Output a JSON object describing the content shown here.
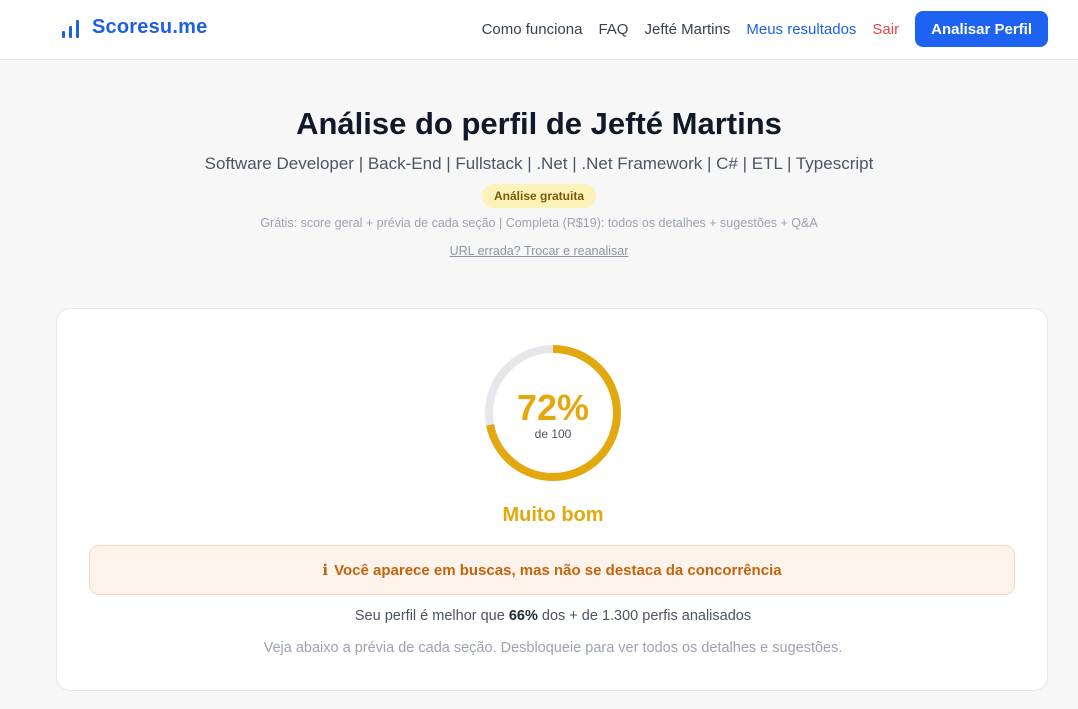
{
  "header": {
    "brand": "Scoresu.me",
    "nav": {
      "how_it_works": "Como funciona",
      "faq": "FAQ",
      "user_name": "Jefté Martins",
      "my_results": "Meus resultados",
      "logout": "Sair",
      "cta": "Analisar Perfil"
    }
  },
  "hero": {
    "title": "Análise do perfil de Jefté Martins",
    "headline": "Software Developer | Back-End | Fullstack | .Net | .Net Framework | C# | ETL | Typescript",
    "badge": "Análise gratuita",
    "pricing_note": "Grátis: score geral + prévia de cada seção | Completa (R$19): todos os detalhes + sugestões + Q&A",
    "change_url": "URL errada? Trocar e reanalisar"
  },
  "score": {
    "value": 72,
    "value_label": "72%",
    "total_label": "de 100",
    "rating": "Muito bom",
    "alert_icon": "ℹ",
    "alert_text": "Você aparece em buscas, mas não se destaca da concorrência",
    "compare_prefix": "Seu perfil é melhor que ",
    "compare_percent": "66%",
    "compare_suffix": " dos + de 1.300 perfis analisados",
    "hint": "Veja abaixo a prévia de cada seção. Desbloqueie para ver todos os detalhes e sugestões."
  },
  "colors": {
    "brand": "#1d5fe6",
    "cta": "#1d62f0",
    "score": "#e3a80d",
    "gauge_track": "#e5e7eb",
    "logout": "#e04848",
    "alert_text": "#c2640f"
  },
  "icons": {
    "brand": "bar-chart-icon",
    "alert": "info-icon"
  }
}
